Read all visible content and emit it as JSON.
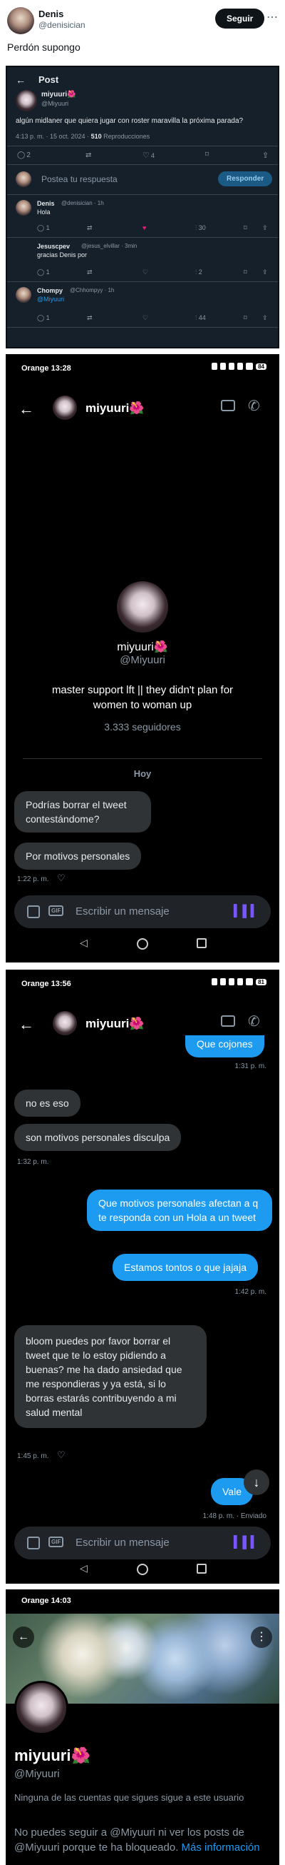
{
  "tweet": {
    "author_name": "Denis",
    "author_handle": "@denisician",
    "follow_label": "Seguir",
    "text": "Perdón supongo"
  },
  "ss1": {
    "header_title": "Post",
    "post_author": "miyuuri🌺",
    "post_handle": "@Miyuuri",
    "post_text": "algún midlaner que quiera jugar con roster maravilla la próxima parada?",
    "post_meta": "4:13 p. m. · 15 oct. 2024 · ",
    "post_views": "510",
    "post_views_label": " Reproducciones",
    "counts": {
      "replies": "2",
      "likes": "4"
    },
    "reply_placeholder": "Postea tu respuesta",
    "reply_button": "Responder",
    "replies": [
      {
        "name": "Denis",
        "meta": "@denisician · 1h",
        "text": "Hola",
        "c1": "1",
        "likes": "",
        "views": "30"
      },
      {
        "name": "Jesuscpev",
        "meta": "@jesus_elvillar · 3min",
        "text": "gracias Denis por",
        "c1": "1",
        "likes": "",
        "views": "2"
      },
      {
        "name": "Chompy",
        "meta": "@Chhompyy · 1h",
        "text": "@Miyuuri",
        "c1": "1",
        "likes": "",
        "views": "44"
      }
    ]
  },
  "ss2": {
    "status_carrier": "Orange",
    "status_time": "13:28",
    "battery": "84",
    "chat_name": "miyuuri🌺",
    "profile_name": "miyuuri🌺",
    "profile_handle": "@Miyuuri",
    "bio": "master support lft || they didn't plan for women to woman up",
    "followers": "3.333 seguidores",
    "day_divider": "Hoy",
    "messages": [
      {
        "text": "Podrías borrar el tweet contestándome?"
      },
      {
        "text": "Por motivos personales"
      }
    ],
    "time": "1:22 p. m.",
    "composer_placeholder": "Escribir un mensaje"
  },
  "ss3": {
    "status_carrier": "Orange",
    "status_time": "13:56",
    "battery": "81",
    "chat_name": "miyuuri🌺",
    "cut_message": "Que cojones",
    "t1": "1:31 p. m.",
    "m1": "no es eso",
    "m2": "son motivos personales disculpa",
    "t2": "1:32 p. m.",
    "m3": "Que motivos personales afectan a q te responda con un Hola a un tweet",
    "m4": "Estamos tontos o que jajaja",
    "t3": "1:42 p. m.",
    "m5": "bloom puedes por favor borrar el tweet que te lo estoy pidiendo a buenas? me ha dado ansiedad que me respondieras y ya está, si lo borras estarás contribuyendo a mi salud mental",
    "t4": "1:45 p. m.",
    "m6": "Vale",
    "t5": "1:48 p. m. · Enviado",
    "composer_placeholder": "Escribir un mensaje"
  },
  "ss4": {
    "status_carrier": "Orange",
    "status_time": "14:03",
    "profile_name": "miyuuri🌺",
    "profile_handle": "@Miyuuri",
    "follows_note": "Ninguna de las cuentas que sigues sigue a este usuario",
    "blocked_text": "No puedes seguir a @Miyuuri ni ver los posts de @Miyuuri porque te ha bloqueado. ",
    "more_info": "Más información"
  },
  "colors": {
    "accent": "#1d9bf0",
    "dark_bg": "#15202b",
    "bubble_gray": "#2f3336"
  }
}
